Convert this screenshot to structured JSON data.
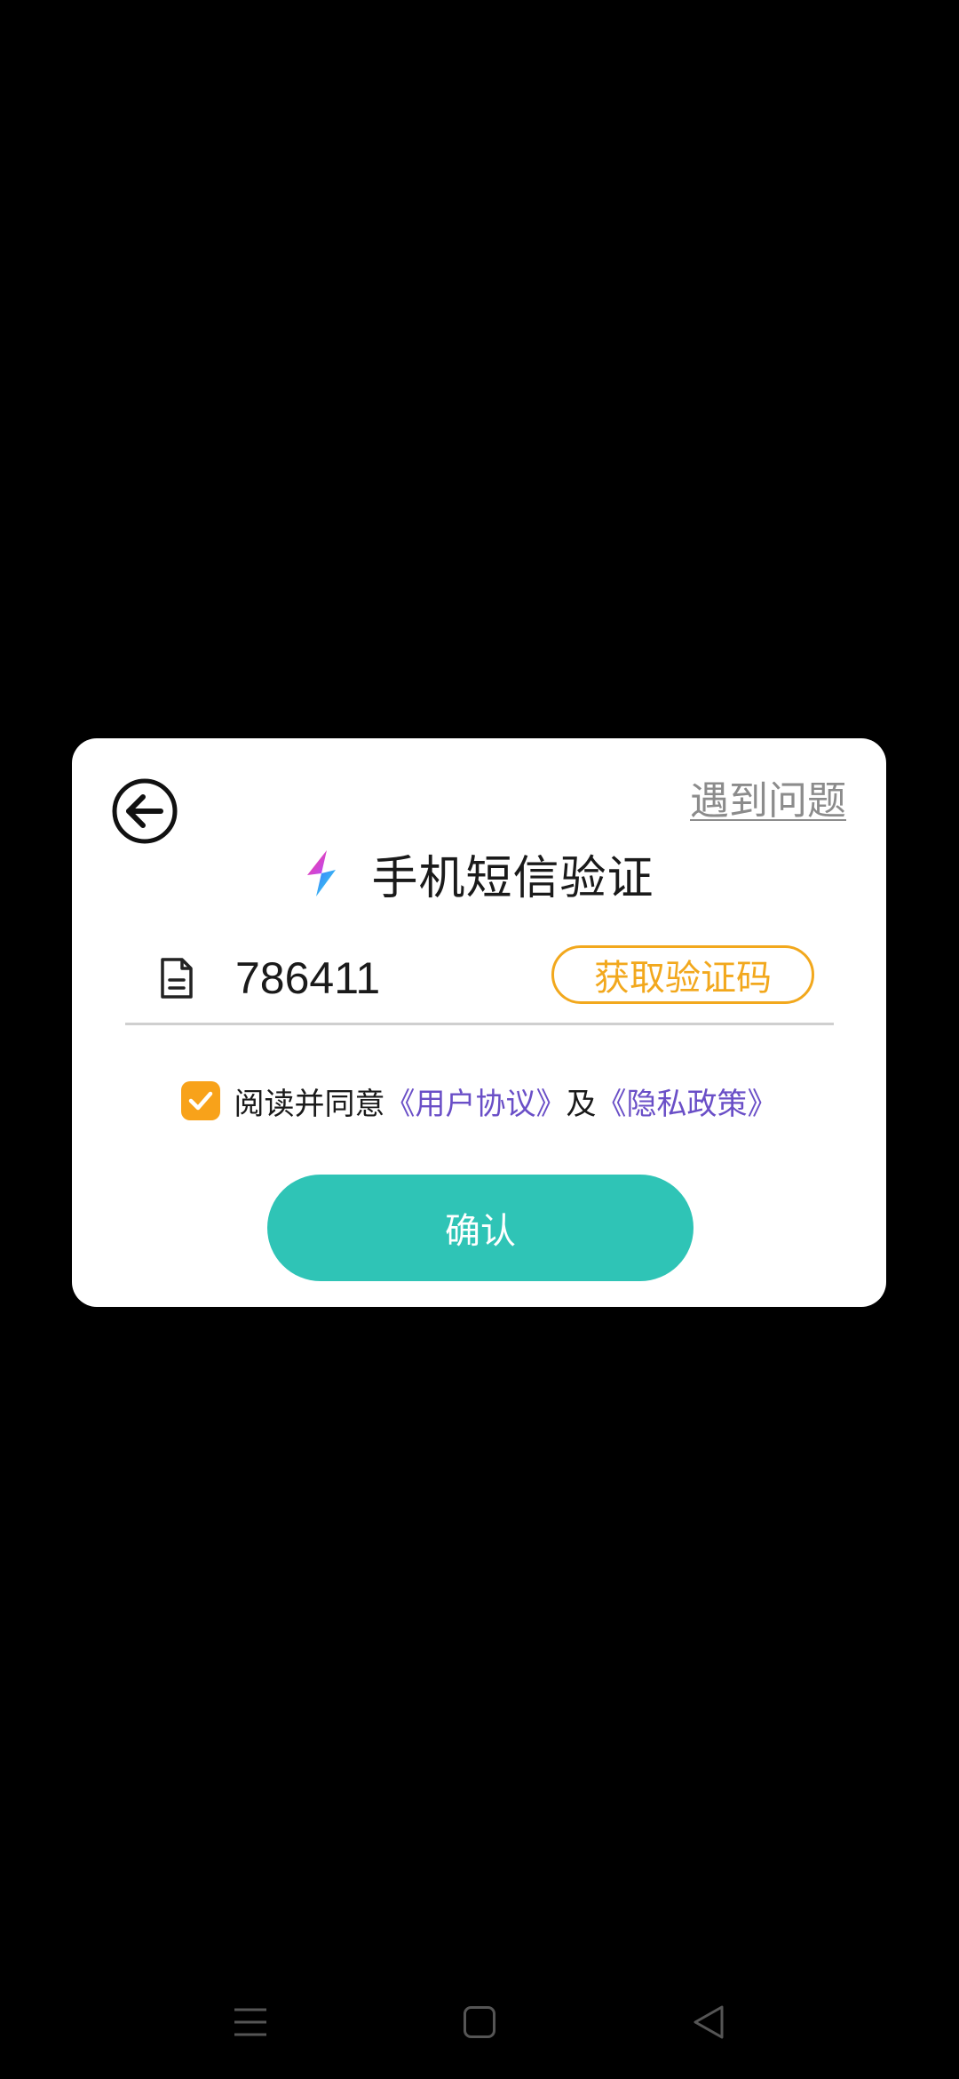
{
  "dialog": {
    "help_link": "遇到问题",
    "title": "手机短信验证",
    "code_input": {
      "value": "786411",
      "placeholder": ""
    },
    "get_code_label": "获取验证码",
    "agreement": {
      "checked": true,
      "prefix": "阅读并同意",
      "user_agreement": "《用户协议》",
      "conjunction": "及",
      "privacy_policy": "《隐私政策》"
    },
    "confirm_label": "确认"
  },
  "icons": {
    "back": "back-arrow-circle-icon",
    "brand": "lightning-bolt-icon",
    "document": "document-icon",
    "checkbox": "checkmark-icon",
    "nav_menu": "menu-lines-icon",
    "nav_home": "home-square-icon",
    "nav_back": "back-triangle-icon"
  },
  "colors": {
    "background": "#000000",
    "card": "#ffffff",
    "accent_orange": "#f2a81d",
    "checkbox": "#f8a21a",
    "link_purple": "#6a4fc7",
    "confirm_teal": "#2fc4b6",
    "help_gray": "#8c8c8c"
  }
}
